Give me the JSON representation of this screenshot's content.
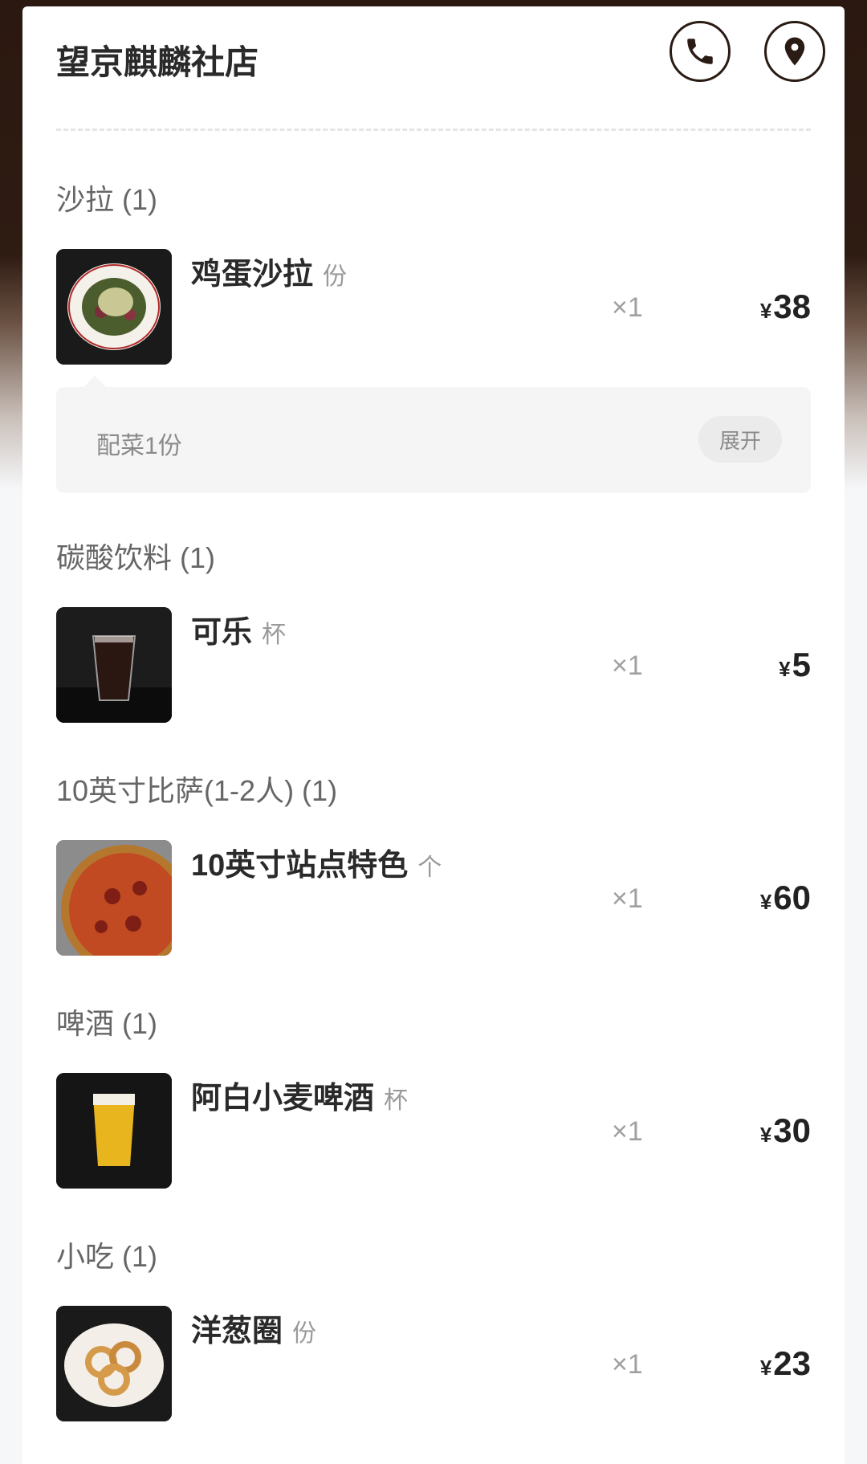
{
  "store": {
    "name": "望京麒麟社店"
  },
  "icons": {
    "phone": "phone-icon",
    "location": "location-pin-icon"
  },
  "colors": {
    "header_bg": "#2b1810",
    "icon_stroke": "#2a1b14",
    "text_primary": "#2a2a2a",
    "text_muted": "#9a9a9a"
  },
  "categories": [
    {
      "title": "沙拉 (1)",
      "items": [
        {
          "name": "鸡蛋沙拉",
          "unit": "份",
          "qty": "×1",
          "currency": "¥",
          "price": "38"
        }
      ]
    },
    {
      "title": "碳酸饮料 (1)",
      "items": [
        {
          "name": "可乐",
          "unit": "杯",
          "qty": "×1",
          "currency": "¥",
          "price": "5"
        }
      ]
    },
    {
      "title": "10英寸比萨(1-2人) (1)",
      "items": [
        {
          "name": "10英寸站点特色",
          "unit": "个",
          "qty": "×1",
          "currency": "¥",
          "price": "60"
        }
      ]
    },
    {
      "title": "啤酒 (1)",
      "items": [
        {
          "name": "阿白小麦啤酒",
          "unit": "杯",
          "qty": "×1",
          "currency": "¥",
          "price": "30"
        }
      ]
    },
    {
      "title": "小吃 (1)",
      "items": [
        {
          "name": "洋葱圈",
          "unit": "份",
          "qty": "×1",
          "currency": "¥",
          "price": "23"
        }
      ]
    }
  ],
  "addon": {
    "text": "配菜1份",
    "expand_label": "展开"
  }
}
